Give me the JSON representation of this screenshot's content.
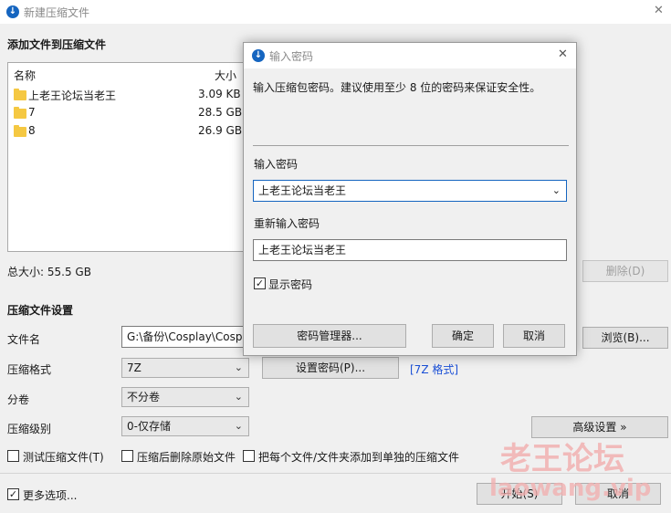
{
  "window": {
    "title": "新建压缩文件",
    "close": "✕"
  },
  "add_section": {
    "heading": "添加文件到压缩文件",
    "columns": {
      "name": "名称",
      "size": "大小"
    },
    "files": [
      {
        "name": "上老王论坛当老王",
        "size": "3.09 KB"
      },
      {
        "name": "7",
        "size": "28.5 GB"
      },
      {
        "name": "8",
        "size": "26.9 GB"
      }
    ],
    "total": "总大小: 55.5 GB",
    "delete_btn": "删除(D)"
  },
  "settings": {
    "heading": "压缩文件设置",
    "filename_label": "文件名",
    "filename_value": "G:\\备份\\Cosplay\\Cosplay",
    "browse_btn": "浏览(B)...",
    "format_label": "压缩格式",
    "format_value": "7Z",
    "set_password_btn": "设置密码(P)...",
    "format_link": "[7Z 格式]",
    "volume_label": "分卷",
    "volume_value": "不分卷",
    "level_label": "压缩级别",
    "level_value": "0-仅存储",
    "advanced_btn": "高级设置 »",
    "check_test": "测试压缩文件(T)",
    "check_delete": "压缩后删除原始文件",
    "check_separate": "把每个文件/文件夹添加到单独的压缩文件",
    "more_options": "更多选项...",
    "start_btn": "开始(S)",
    "cancel_btn": "取消"
  },
  "password_dialog": {
    "title": "输入密码",
    "close": "✕",
    "description": "输入压缩包密码。建议使用至少 8 位的密码来保证安全性。",
    "enter_label": "输入密码",
    "enter_value": "上老王论坛当老王",
    "reenter_label": "重新输入密码",
    "reenter_value": "上老王论坛当老王",
    "show_password": "显示密码",
    "manager_btn": "密码管理器...",
    "ok_btn": "确定",
    "cancel_btn": "取消"
  },
  "watermark": {
    "line1": "老王论坛",
    "line2": "laowang.vip"
  },
  "colors": {
    "accent": "#1565c0",
    "link": "#1a4fd6",
    "watermark": "#f2b1b1"
  }
}
